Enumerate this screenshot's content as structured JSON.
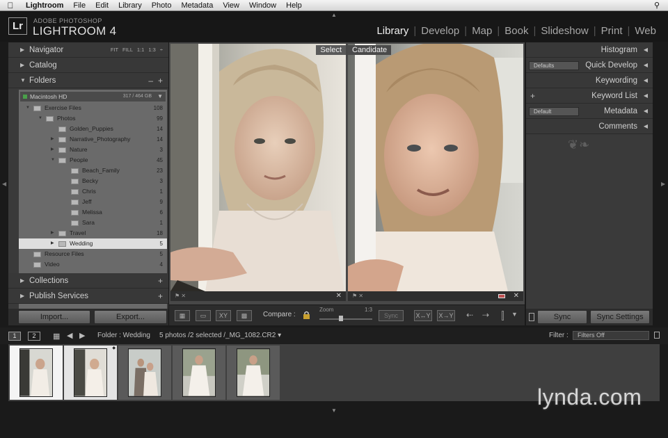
{
  "menubar": {
    "app": "Lightroom",
    "items": [
      "File",
      "Edit",
      "Library",
      "Photo",
      "Metadata",
      "View",
      "Window",
      "Help"
    ]
  },
  "identity": {
    "badge": "Lr",
    "line1": "ADOBE PHOTOSHOP",
    "line2": "LIGHTROOM 4",
    "modules": [
      "Library",
      "Develop",
      "Map",
      "Book",
      "Slideshow",
      "Print",
      "Web"
    ],
    "active_module": "Library"
  },
  "left": {
    "navigator": "Navigator",
    "navigator_opts": "FIT FILL 1:1 1:3 ÷",
    "catalog": "Catalog",
    "folders": "Folders",
    "volume": {
      "name": "Macintosh HD",
      "size": "317 / 464 GB"
    },
    "tree": [
      {
        "name": "Exercise Files",
        "count": "108",
        "depth": 0,
        "arrow": "open"
      },
      {
        "name": "Photos",
        "count": "99",
        "depth": 1,
        "arrow": "open"
      },
      {
        "name": "Golden_Puppies",
        "count": "14",
        "depth": 2,
        "arrow": "none"
      },
      {
        "name": "Narrative_Photography",
        "count": "14",
        "depth": 2,
        "arrow": "closed"
      },
      {
        "name": "Nature",
        "count": "3",
        "depth": 2,
        "arrow": "closed"
      },
      {
        "name": "People",
        "count": "45",
        "depth": 2,
        "arrow": "open"
      },
      {
        "name": "Beach_Family",
        "count": "23",
        "depth": 3,
        "arrow": "none"
      },
      {
        "name": "Becky",
        "count": "3",
        "depth": 3,
        "arrow": "none"
      },
      {
        "name": "Chris",
        "count": "1",
        "depth": 3,
        "arrow": "none"
      },
      {
        "name": "Jeff",
        "count": "9",
        "depth": 3,
        "arrow": "none"
      },
      {
        "name": "Melissa",
        "count": "6",
        "depth": 3,
        "arrow": "none"
      },
      {
        "name": "Sara",
        "count": "1",
        "depth": 3,
        "arrow": "none"
      },
      {
        "name": "Travel",
        "count": "18",
        "depth": 2,
        "arrow": "closed"
      },
      {
        "name": "Wedding",
        "count": "5",
        "depth": 2,
        "arrow": "closed",
        "selected": true
      },
      {
        "name": "Resource Files",
        "count": "5",
        "depth": 0,
        "arrow": "none"
      },
      {
        "name": "Video",
        "count": "4",
        "depth": 0,
        "arrow": "none"
      }
    ],
    "collections": "Collections",
    "publish": "Publish Services",
    "import_btn": "Import...",
    "export_btn": "Export..."
  },
  "center": {
    "select_label": "Select",
    "candidate_label": "Candidate",
    "compare_label": "Compare :",
    "zoom_label": "Zoom",
    "zoom_value": "1:3",
    "zoom_level": 0.4,
    "sync_label": "Sync"
  },
  "right": {
    "histogram": "Histogram",
    "quick_develop": "Quick Develop",
    "qd_preset": "Defaults",
    "keywording": "Keywording",
    "keyword_list": "Keyword List",
    "metadata": "Metadata",
    "md_preset": "Default",
    "comments": "Comments",
    "sync_btn": "Sync",
    "sync_settings_btn": "Sync Settings"
  },
  "filmstrip": {
    "monitor1": "1",
    "monitor2": "2",
    "source": "Folder : Wedding",
    "count_text": "5 photos /2 selected /_MG_1082.CR2 ▾",
    "filter_label": "Filter :",
    "filter_value": "Filters Off",
    "thumbs": [
      {
        "state": "cur"
      },
      {
        "state": "sel"
      },
      {
        "state": "normal"
      },
      {
        "state": "normal"
      },
      {
        "state": "normal"
      }
    ]
  },
  "watermark": "lynda.com",
  "colors": {
    "accent": "#f0f0f0",
    "panel": "#3a3a3a",
    "selection": "#dedede"
  }
}
